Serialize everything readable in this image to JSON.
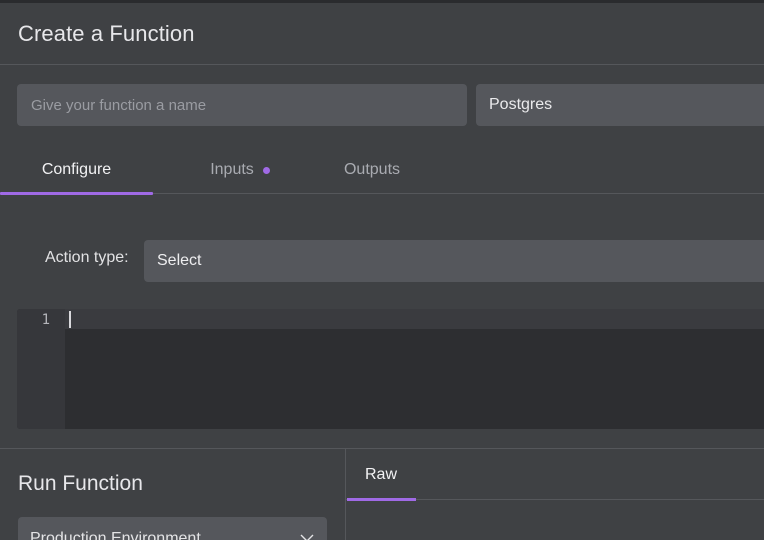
{
  "header": {
    "title": "Create a Function"
  },
  "form": {
    "name_placeholder": "Give your function a name",
    "name_value": "",
    "datasource": "Postgres"
  },
  "tabs": [
    {
      "label": "Configure",
      "active": true
    },
    {
      "label": "Inputs",
      "active": false,
      "has_indicator": true
    },
    {
      "label": "Outputs",
      "active": false
    }
  ],
  "configure": {
    "action_type_label": "Action type:",
    "action_type_value": "Select"
  },
  "editor": {
    "line_numbers": [
      "1"
    ],
    "content": ""
  },
  "run": {
    "title": "Run Function",
    "environment": "Production Environment"
  },
  "output": {
    "tabs": [
      {
        "label": "Raw",
        "active": true
      }
    ]
  },
  "colors": {
    "accent": "#a06ae6",
    "background": "#3f4144",
    "field": "#55575c",
    "editor": "#2d2e31"
  }
}
